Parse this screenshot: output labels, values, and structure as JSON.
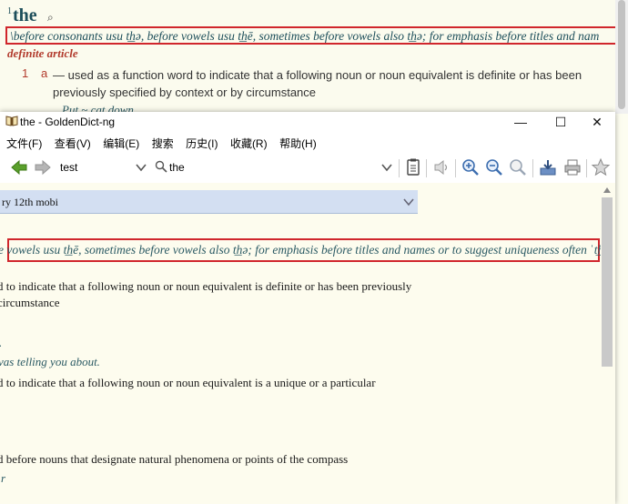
{
  "background": {
    "sup": "1",
    "headword": "the",
    "pronunciation": "\\before consonants usu t͟hə, before vowels usu t͟hē, sometimes before vowels also t͟hə; for emphasis before titles and nam",
    "pos": "definite article",
    "sense_number": "1",
    "sense_letter": "a",
    "definition": "— used as a function word to indicate that a following noun or noun equivalent is definite or has been previously specified by context or by circumstance",
    "example": "Put ~ cat down"
  },
  "window": {
    "title": "the - GoldenDict-ng",
    "controls": {
      "minimize": "—",
      "maximize": "☐",
      "close": "✕"
    }
  },
  "menu": [
    "文件(F)",
    "查看(V)",
    "编辑(E)",
    "搜索",
    "历史(I)",
    "收藏(R)",
    "帮助(H)"
  ],
  "toolbar": {
    "group_value": "test",
    "search_value": "the",
    "icons": [
      "back-icon",
      "forward-icon",
      "scan-popup-icon",
      "pronounce-icon",
      "zoom-in-icon",
      "zoom-out-icon",
      "zoom-reset-icon",
      "save-icon",
      "print-icon",
      "favorite-star-icon"
    ]
  },
  "content": {
    "dict_name": "ry 12th mobi",
    "pronunciation": "e vowels usu t͟hē, sometimes before vowels also t͟hə; for emphasis before titles and names or to suggest uniqueness often ˈt͟hē\\",
    "lines": [
      {
        "text": "d to indicate that a following noun or noun equivalent is definite or has been previously",
        "italic": false
      },
      {
        "text": " circumstance",
        "italic": false
      },
      {
        "text": ".",
        "italic": true
      },
      {
        "text": "vas telling you about.",
        "italic": true
      },
      {
        "text": "d to indicate that a following noun or noun equivalent is a unique or a particular",
        "italic": false
      },
      {
        "text": "d before nouns that designate natural phenomena or points of the compass",
        "italic": false
      },
      {
        "text": "r",
        "italic": true
      }
    ]
  },
  "colors": {
    "highlight_border": "#d0262c",
    "headword": "#1d4e5a",
    "pos": "#b23a2c",
    "dict_bar": "#d3dff2"
  }
}
